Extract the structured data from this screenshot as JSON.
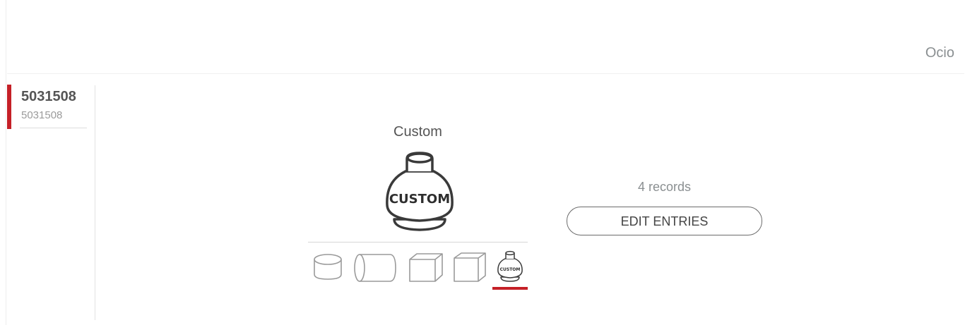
{
  "header": {
    "user": "Ocio"
  },
  "sidebar": {
    "item_code": "5031508",
    "item_subtitle": "5031508"
  },
  "shape": {
    "title": "Custom",
    "preview_text": "CUSTOM",
    "options": [
      {
        "icon": "cylinder-upright-icon"
      },
      {
        "icon": "cylinder-horizontal-icon"
      },
      {
        "icon": "box-icon"
      },
      {
        "icon": "cube-icon"
      },
      {
        "icon": "custom-bottle-icon",
        "label": "CUSTOM",
        "selected": true
      }
    ]
  },
  "records": {
    "count_text": "4 records",
    "edit_label": "EDIT ENTRIES"
  },
  "colors": {
    "accent": "#c52027",
    "muted_text": "#8a8f91",
    "icon_stroke": "#9a9a9a"
  }
}
